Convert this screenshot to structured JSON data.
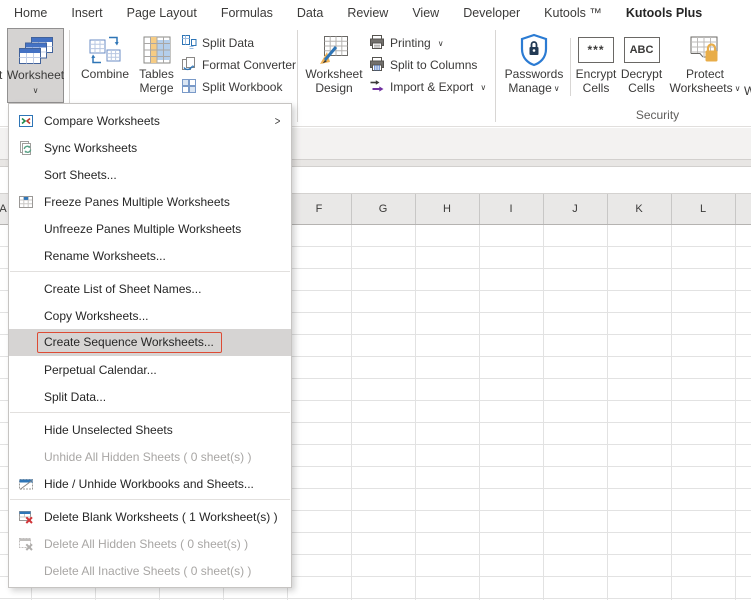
{
  "tabs": [
    {
      "label": "Home",
      "active": false
    },
    {
      "label": "Insert",
      "active": false
    },
    {
      "label": "Page Layout",
      "active": false
    },
    {
      "label": "Formulas",
      "active": false
    },
    {
      "label": "Data",
      "active": false
    },
    {
      "label": "Review",
      "active": false
    },
    {
      "label": "View",
      "active": false
    },
    {
      "label": "Developer",
      "active": false
    },
    {
      "label": "Kutools ™",
      "active": false
    },
    {
      "label": "Kutools Plus",
      "active": true
    }
  ],
  "ribbon": {
    "edge_sliver": "t",
    "worksheet_button": {
      "label": "Worksheet",
      "pressed": true,
      "dropdown": true
    },
    "combine_button": {
      "label": "Combine"
    },
    "tables_merge_button": {
      "line1": "Tables",
      "line2": "Merge"
    },
    "small_buttons_1": [
      {
        "label": "Split Data",
        "icon": "split-data",
        "dropdown": false
      },
      {
        "label": "Format Converter",
        "icon": "format-converter",
        "dropdown": false
      },
      {
        "label": "Split Workbook",
        "icon": "split-workbook",
        "dropdown": false
      }
    ],
    "design_button": {
      "line1": "Worksheet",
      "line2": "Design"
    },
    "small_buttons_2": [
      {
        "label": "Printing",
        "icon": "printing",
        "dropdown": true
      },
      {
        "label": "Split to Columns",
        "icon": "split-columns",
        "dropdown": false
      },
      {
        "label": "Import & Export",
        "icon": "import-export",
        "dropdown": true
      }
    ],
    "security_group": {
      "label": "Security",
      "passwords_button": {
        "line1": "Passwords",
        "line2": "Manage",
        "dropdown": true
      },
      "encrypt_button": {
        "icon_text": "***",
        "line1": "Encrypt",
        "line2": "Cells"
      },
      "decrypt_button": {
        "icon_text": "ABC",
        "line1": "Decrypt",
        "line2": "Cells"
      },
      "protect_button": {
        "line1": "Protect",
        "line2": "Worksheets",
        "dropdown": true
      },
      "cutoff_label": "W"
    }
  },
  "menu": {
    "sections": [
      {
        "items": [
          {
            "label": "Compare Worksheets",
            "icon": "compare",
            "submenu": true
          },
          {
            "label": "Sync Worksheets",
            "icon": "sync"
          },
          {
            "label": "Sort Sheets..."
          },
          {
            "label": "Freeze Panes Multiple Worksheets",
            "icon": "freeze"
          },
          {
            "label": "Unfreeze Panes Multiple Worksheets"
          },
          {
            "label": "Rename Worksheets..."
          }
        ]
      },
      {
        "items": [
          {
            "label": "Create List of Sheet Names..."
          },
          {
            "label": "Copy Worksheets..."
          },
          {
            "label": "Create Sequence Worksheets...",
            "highlighted": true
          },
          {
            "label": "Perpetual Calendar..."
          },
          {
            "label": "Split Data..."
          }
        ]
      },
      {
        "items": [
          {
            "label": "Hide Unselected Sheets"
          },
          {
            "label": "Unhide All Hidden Sheets ( 0 sheet(s) )",
            "disabled": true
          },
          {
            "label": "Hide / Unhide Workbooks and Sheets...",
            "icon": "hide-unhide"
          }
        ]
      },
      {
        "items": [
          {
            "label": "Delete Blank Worksheets ( 1 Worksheet(s) )",
            "icon": "delete-blank"
          },
          {
            "label": "Delete All Hidden Sheets ( 0 sheet(s) )",
            "icon": "delete-hidden",
            "disabled": true
          },
          {
            "label": "Delete All Inactive Sheets ( 0 sheet(s) )",
            "disabled": true
          }
        ]
      }
    ]
  },
  "sheet": {
    "column_headers": [
      "F",
      "G",
      "H",
      "I",
      "J",
      "K",
      "L"
    ],
    "partial_left_header": "A"
  },
  "colors": {
    "active_tab_green": "#217346",
    "highlight_red": "#dd4b34",
    "menu_highlight_bg": "#d6d4d3",
    "disabled_text": "#a8a6a4",
    "icon_blue": "#2e75b6",
    "sheet_header_blue": "#4472c4",
    "lock_orange": "#e8ad49",
    "shield_blue": "#2b7bd3",
    "import_purple": "#7030a0"
  }
}
